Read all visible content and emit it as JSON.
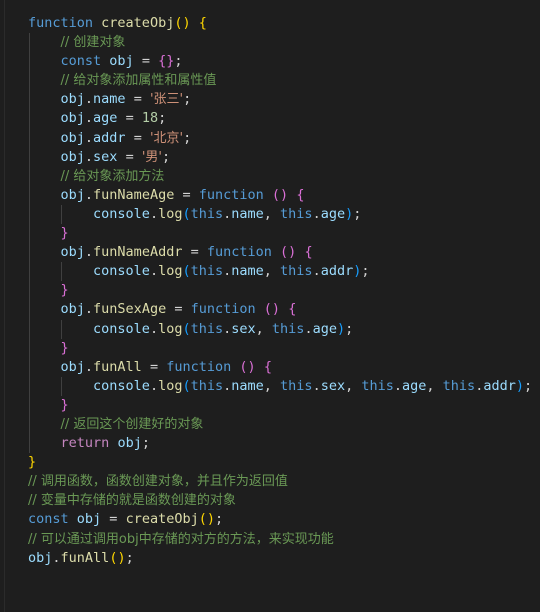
{
  "editor": {
    "language": "javascript",
    "theme": "dark-plus",
    "background": "#1e1e1e",
    "foreground": "#d4d4d4",
    "colors": {
      "keyword": "#569cd6",
      "control": "#c586c0",
      "function": "#dcdcaa",
      "variable": "#9cdcfe",
      "string": "#ce9178",
      "number": "#b5cea8",
      "comment": "#6a9955",
      "punctuation": "#d4d4d4",
      "bracket_level_1": "#ffd700",
      "bracket_level_2": "#da70d6",
      "bracket_level_3": "#179fff",
      "indent_guide": "#404040"
    }
  },
  "code": {
    "lines": [
      {
        "indent": 0,
        "tokens": [
          {
            "t": "function",
            "c": "kw"
          },
          {
            "t": " ",
            "c": "p"
          },
          {
            "t": "createObj",
            "c": "fn"
          },
          {
            "t": "(",
            "c": "br1"
          },
          {
            "t": ")",
            "c": "br1"
          },
          {
            "t": " ",
            "c": "p"
          },
          {
            "t": "{",
            "c": "br1"
          }
        ]
      },
      {
        "indent": 1,
        "tokens": [
          {
            "t": "// 创建对象",
            "c": "cmt"
          }
        ]
      },
      {
        "indent": 1,
        "tokens": [
          {
            "t": "const",
            "c": "kw"
          },
          {
            "t": " ",
            "c": "p"
          },
          {
            "t": "obj",
            "c": "var"
          },
          {
            "t": " ",
            "c": "p"
          },
          {
            "t": "=",
            "c": "p"
          },
          {
            "t": " ",
            "c": "p"
          },
          {
            "t": "{",
            "c": "br2"
          },
          {
            "t": "}",
            "c": "br2"
          },
          {
            "t": ";",
            "c": "p"
          }
        ]
      },
      {
        "indent": 1,
        "tokens": [
          {
            "t": "// 给对象添加属性和属性值",
            "c": "cmt"
          }
        ]
      },
      {
        "indent": 1,
        "tokens": [
          {
            "t": "obj",
            "c": "var"
          },
          {
            "t": ".",
            "c": "p"
          },
          {
            "t": "name",
            "c": "prop"
          },
          {
            "t": " = ",
            "c": "p"
          },
          {
            "t": "'张三'",
            "c": "str"
          },
          {
            "t": ";",
            "c": "p"
          }
        ]
      },
      {
        "indent": 1,
        "tokens": [
          {
            "t": "obj",
            "c": "var"
          },
          {
            "t": ".",
            "c": "p"
          },
          {
            "t": "age",
            "c": "prop"
          },
          {
            "t": " = ",
            "c": "p"
          },
          {
            "t": "18",
            "c": "num"
          },
          {
            "t": ";",
            "c": "p"
          }
        ]
      },
      {
        "indent": 1,
        "tokens": [
          {
            "t": "obj",
            "c": "var"
          },
          {
            "t": ".",
            "c": "p"
          },
          {
            "t": "addr",
            "c": "prop"
          },
          {
            "t": " = ",
            "c": "p"
          },
          {
            "t": "'北京'",
            "c": "str"
          },
          {
            "t": ";",
            "c": "p"
          }
        ]
      },
      {
        "indent": 1,
        "tokens": [
          {
            "t": "obj",
            "c": "var"
          },
          {
            "t": ".",
            "c": "p"
          },
          {
            "t": "sex",
            "c": "prop"
          },
          {
            "t": " = ",
            "c": "p"
          },
          {
            "t": "'男'",
            "c": "str"
          },
          {
            "t": ";",
            "c": "p"
          }
        ]
      },
      {
        "indent": 1,
        "tokens": [
          {
            "t": "// 给对象添加方法",
            "c": "cmt"
          }
        ]
      },
      {
        "indent": 1,
        "tokens": [
          {
            "t": "obj",
            "c": "var"
          },
          {
            "t": ".",
            "c": "p"
          },
          {
            "t": "funNameAge",
            "c": "fn"
          },
          {
            "t": " = ",
            "c": "p"
          },
          {
            "t": "function",
            "c": "kw"
          },
          {
            "t": " ",
            "c": "p"
          },
          {
            "t": "(",
            "c": "br2"
          },
          {
            "t": ")",
            "c": "br2"
          },
          {
            "t": " ",
            "c": "p"
          },
          {
            "t": "{",
            "c": "br2"
          }
        ]
      },
      {
        "indent": 2,
        "tokens": [
          {
            "t": "console",
            "c": "var"
          },
          {
            "t": ".",
            "c": "p"
          },
          {
            "t": "log",
            "c": "fn"
          },
          {
            "t": "(",
            "c": "br3"
          },
          {
            "t": "this",
            "c": "kw"
          },
          {
            "t": ".",
            "c": "p"
          },
          {
            "t": "name",
            "c": "prop"
          },
          {
            "t": ", ",
            "c": "p"
          },
          {
            "t": "this",
            "c": "kw"
          },
          {
            "t": ".",
            "c": "p"
          },
          {
            "t": "age",
            "c": "prop"
          },
          {
            "t": ")",
            "c": "br3"
          },
          {
            "t": ";",
            "c": "p"
          }
        ]
      },
      {
        "indent": 1,
        "tokens": [
          {
            "t": "}",
            "c": "br2"
          }
        ]
      },
      {
        "indent": 1,
        "tokens": [
          {
            "t": "obj",
            "c": "var"
          },
          {
            "t": ".",
            "c": "p"
          },
          {
            "t": "funNameAddr",
            "c": "fn"
          },
          {
            "t": " = ",
            "c": "p"
          },
          {
            "t": "function",
            "c": "kw"
          },
          {
            "t": " ",
            "c": "p"
          },
          {
            "t": "(",
            "c": "br2"
          },
          {
            "t": ")",
            "c": "br2"
          },
          {
            "t": " ",
            "c": "p"
          },
          {
            "t": "{",
            "c": "br2"
          }
        ]
      },
      {
        "indent": 2,
        "tokens": [
          {
            "t": "console",
            "c": "var"
          },
          {
            "t": ".",
            "c": "p"
          },
          {
            "t": "log",
            "c": "fn"
          },
          {
            "t": "(",
            "c": "br3"
          },
          {
            "t": "this",
            "c": "kw"
          },
          {
            "t": ".",
            "c": "p"
          },
          {
            "t": "name",
            "c": "prop"
          },
          {
            "t": ", ",
            "c": "p"
          },
          {
            "t": "this",
            "c": "kw"
          },
          {
            "t": ".",
            "c": "p"
          },
          {
            "t": "addr",
            "c": "prop"
          },
          {
            "t": ")",
            "c": "br3"
          },
          {
            "t": ";",
            "c": "p"
          }
        ]
      },
      {
        "indent": 1,
        "tokens": [
          {
            "t": "}",
            "c": "br2"
          }
        ]
      },
      {
        "indent": 1,
        "tokens": [
          {
            "t": "obj",
            "c": "var"
          },
          {
            "t": ".",
            "c": "p"
          },
          {
            "t": "funSexAge",
            "c": "fn"
          },
          {
            "t": " = ",
            "c": "p"
          },
          {
            "t": "function",
            "c": "kw"
          },
          {
            "t": " ",
            "c": "p"
          },
          {
            "t": "(",
            "c": "br2"
          },
          {
            "t": ")",
            "c": "br2"
          },
          {
            "t": " ",
            "c": "p"
          },
          {
            "t": "{",
            "c": "br2"
          }
        ]
      },
      {
        "indent": 2,
        "tokens": [
          {
            "t": "console",
            "c": "var"
          },
          {
            "t": ".",
            "c": "p"
          },
          {
            "t": "log",
            "c": "fn"
          },
          {
            "t": "(",
            "c": "br3"
          },
          {
            "t": "this",
            "c": "kw"
          },
          {
            "t": ".",
            "c": "p"
          },
          {
            "t": "sex",
            "c": "prop"
          },
          {
            "t": ", ",
            "c": "p"
          },
          {
            "t": "this",
            "c": "kw"
          },
          {
            "t": ".",
            "c": "p"
          },
          {
            "t": "age",
            "c": "prop"
          },
          {
            "t": ")",
            "c": "br3"
          },
          {
            "t": ";",
            "c": "p"
          }
        ]
      },
      {
        "indent": 1,
        "tokens": [
          {
            "t": "}",
            "c": "br2"
          }
        ]
      },
      {
        "indent": 1,
        "tokens": [
          {
            "t": "obj",
            "c": "var"
          },
          {
            "t": ".",
            "c": "p"
          },
          {
            "t": "funAll",
            "c": "fn"
          },
          {
            "t": " = ",
            "c": "p"
          },
          {
            "t": "function",
            "c": "kw"
          },
          {
            "t": " ",
            "c": "p"
          },
          {
            "t": "(",
            "c": "br2"
          },
          {
            "t": ")",
            "c": "br2"
          },
          {
            "t": " ",
            "c": "p"
          },
          {
            "t": "{",
            "c": "br2"
          }
        ]
      },
      {
        "indent": 2,
        "tokens": [
          {
            "t": "console",
            "c": "var"
          },
          {
            "t": ".",
            "c": "p"
          },
          {
            "t": "log",
            "c": "fn"
          },
          {
            "t": "(",
            "c": "br3"
          },
          {
            "t": "this",
            "c": "kw"
          },
          {
            "t": ".",
            "c": "p"
          },
          {
            "t": "name",
            "c": "prop"
          },
          {
            "t": ", ",
            "c": "p"
          },
          {
            "t": "this",
            "c": "kw"
          },
          {
            "t": ".",
            "c": "p"
          },
          {
            "t": "sex",
            "c": "prop"
          },
          {
            "t": ", ",
            "c": "p"
          },
          {
            "t": "this",
            "c": "kw"
          },
          {
            "t": ".",
            "c": "p"
          },
          {
            "t": "age",
            "c": "prop"
          },
          {
            "t": ", ",
            "c": "p"
          },
          {
            "t": "this",
            "c": "kw"
          },
          {
            "t": ".",
            "c": "p"
          },
          {
            "t": "addr",
            "c": "prop"
          },
          {
            "t": ")",
            "c": "br3"
          },
          {
            "t": ";",
            "c": "p"
          }
        ]
      },
      {
        "indent": 1,
        "tokens": [
          {
            "t": "}",
            "c": "br2"
          }
        ]
      },
      {
        "indent": 1,
        "tokens": [
          {
            "t": "// 返回这个创建好的对象",
            "c": "cmt"
          }
        ]
      },
      {
        "indent": 1,
        "tokens": [
          {
            "t": "return",
            "c": "ctl"
          },
          {
            "t": " ",
            "c": "p"
          },
          {
            "t": "obj",
            "c": "var"
          },
          {
            "t": ";",
            "c": "p"
          }
        ]
      },
      {
        "indent": 0,
        "tokens": [
          {
            "t": "}",
            "c": "br1"
          }
        ]
      },
      {
        "indent": 0,
        "tokens": [
          {
            "t": "// 调用函数，函数创建对象，并且作为返回值",
            "c": "cmt"
          }
        ]
      },
      {
        "indent": 0,
        "tokens": [
          {
            "t": "// 变量中存储的就是函数创建的对象",
            "c": "cmt"
          }
        ]
      },
      {
        "indent": 0,
        "tokens": [
          {
            "t": "const",
            "c": "kw"
          },
          {
            "t": " ",
            "c": "p"
          },
          {
            "t": "obj",
            "c": "var"
          },
          {
            "t": " = ",
            "c": "p"
          },
          {
            "t": "createObj",
            "c": "fn"
          },
          {
            "t": "(",
            "c": "br1"
          },
          {
            "t": ")",
            "c": "br1"
          },
          {
            "t": ";",
            "c": "p"
          }
        ]
      },
      {
        "indent": 0,
        "tokens": [
          {
            "t": "// 可以通过调用obj中存储的对方的方法，来实现功能",
            "c": "cmt"
          }
        ]
      },
      {
        "indent": 0,
        "tokens": [
          {
            "t": "obj",
            "c": "var"
          },
          {
            "t": ".",
            "c": "p"
          },
          {
            "t": "funAll",
            "c": "fn"
          },
          {
            "t": "(",
            "c": "br1"
          },
          {
            "t": ")",
            "c": "br1"
          },
          {
            "t": ";",
            "c": "p"
          }
        ]
      }
    ]
  }
}
